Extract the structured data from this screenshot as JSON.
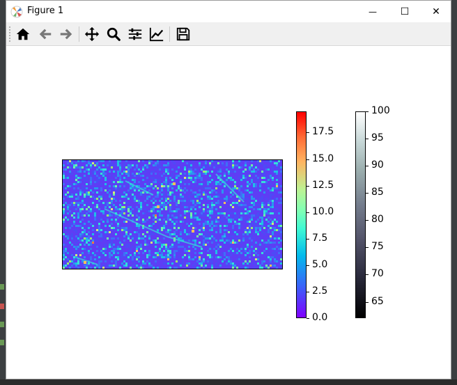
{
  "window": {
    "title": "Figure 1"
  },
  "controls": {
    "minimize_glyph": "—",
    "maximize_glyph": "☐",
    "close_glyph": "✕"
  },
  "toolbar": {
    "tools": [
      {
        "name": "home",
        "icon": "home-icon"
      },
      {
        "name": "back",
        "icon": "arrow-left-icon"
      },
      {
        "name": "forward",
        "icon": "arrow-right-icon"
      },
      {
        "name": "pan",
        "icon": "move-icon"
      },
      {
        "name": "zoom",
        "icon": "magnifier-icon"
      },
      {
        "name": "configure-subplots",
        "icon": "sliders-icon"
      },
      {
        "name": "edit-axis",
        "icon": "line-chart-icon"
      },
      {
        "name": "save",
        "icon": "floppy-disk-icon"
      }
    ]
  },
  "chart_data": {
    "type": "heatmap",
    "colormap_main": "rainbow",
    "colorbars": [
      {
        "colormap": "rainbow",
        "range": [
          0,
          19.5
        ],
        "ticks": [
          "0.0",
          "2.5",
          "5.0",
          "7.5",
          "10.0",
          "12.5",
          "15.0",
          "17.5"
        ],
        "tick_values": [
          0,
          2.5,
          5.0,
          7.5,
          10.0,
          12.5,
          15.0,
          17.5
        ]
      },
      {
        "colormap": "bone",
        "range": [
          62,
          100
        ],
        "ticks": [
          "65",
          "70",
          "75",
          "80",
          "85",
          "90",
          "95",
          "100"
        ],
        "tick_values": [
          65,
          70,
          75,
          80,
          85,
          90,
          95,
          100
        ]
      }
    ],
    "value_distribution": "mostly 0–5 (purple/blue) with scattered linear features 5–12 (cyan/green) and few peaks up to ~17 (orange/red)"
  },
  "colors": {
    "purple": "#5e3df5",
    "cyan": "#34e0d9",
    "green": "#9df36a",
    "yellow": "#ffc05a",
    "red": "#ff2000"
  }
}
